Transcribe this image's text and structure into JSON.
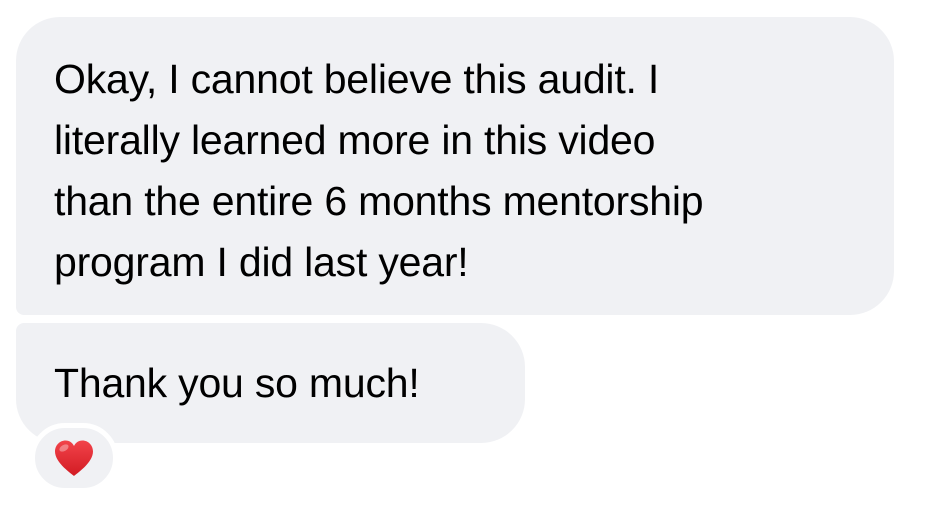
{
  "messages": [
    {
      "text": "Okay, I cannot believe this audit. I\nliterally learned more in this video\nthan the entire 6 months mentorship\nprogram I did last year!"
    },
    {
      "text": "Thank you so much!"
    }
  ],
  "reaction": {
    "icon": "red-heart-icon",
    "color": "#e0252d"
  },
  "colors": {
    "bubble_background": "#f0f1f4",
    "text": "#000000",
    "page_background": "#ffffff"
  }
}
